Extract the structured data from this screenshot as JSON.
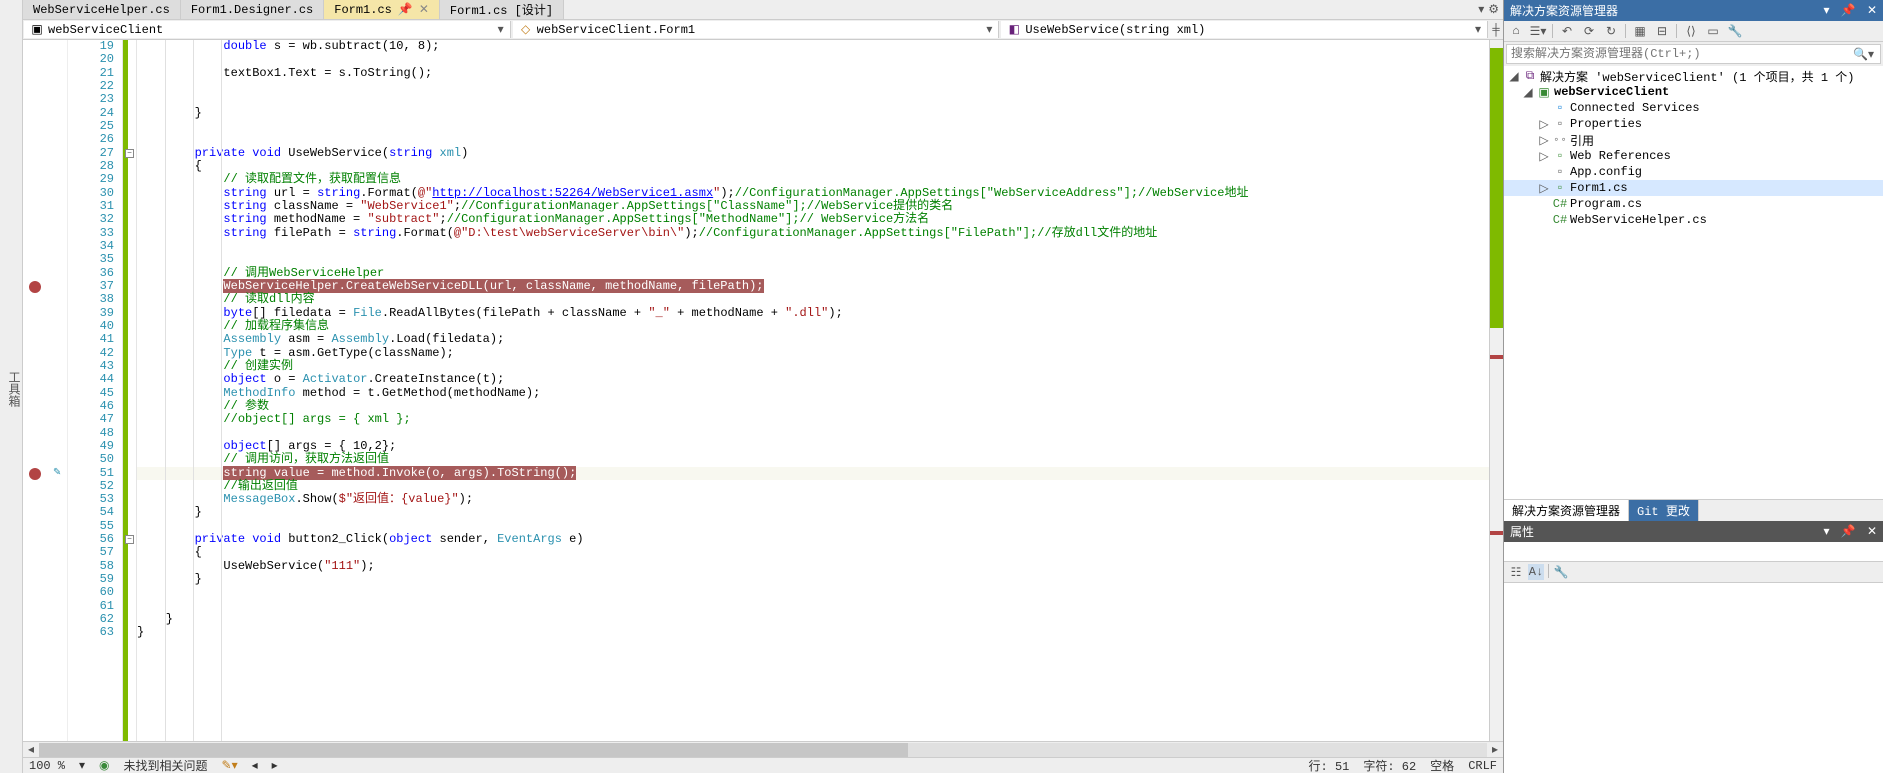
{
  "leftRail": {
    "label": "工具箱"
  },
  "tabs": [
    {
      "label": "WebServiceHelper.cs",
      "active": false,
      "pinned": false
    },
    {
      "label": "Form1.Designer.cs",
      "active": false,
      "pinned": false
    },
    {
      "label": "Form1.cs",
      "active": true,
      "pinned": true
    },
    {
      "label": "Form1.cs [设计]",
      "active": false,
      "pinned": false
    }
  ],
  "nav": {
    "scope": {
      "icon": "project-icon",
      "text": "webServiceClient"
    },
    "class": {
      "icon": "class-icon",
      "text": "webServiceClient.Form1"
    },
    "member": {
      "icon": "method-icon",
      "text": "UseWebService(string xml)"
    }
  },
  "lineStart": 19,
  "code": [
    {
      "n": 19,
      "t": "            double s = wb.subtract(10, 8);",
      "seg": [
        [
          "id",
          "            "
        ],
        [
          "kw",
          "double"
        ],
        [
          "id",
          " s = wb.subtract(10, 8);"
        ]
      ]
    },
    {
      "n": 20,
      "t": "",
      "seg": []
    },
    {
      "n": 21,
      "t": "            textBox1.Text = s.ToString();",
      "seg": [
        [
          "id",
          "            textBox1.Text = s.ToString();"
        ]
      ]
    },
    {
      "n": 22,
      "t": "",
      "seg": []
    },
    {
      "n": 23,
      "t": "",
      "seg": []
    },
    {
      "n": 24,
      "t": "        }",
      "seg": [
        [
          "id",
          "        }"
        ]
      ]
    },
    {
      "n": 25,
      "t": "",
      "seg": []
    },
    {
      "n": 26,
      "t": "",
      "seg": []
    },
    {
      "n": 27,
      "t": "        private void UseWebService(string xml)",
      "fold": "-",
      "seg": [
        [
          "id",
          "        "
        ],
        [
          "kw",
          "private"
        ],
        [
          "id",
          " "
        ],
        [
          "kw",
          "void"
        ],
        [
          "id",
          " UseWebService("
        ],
        [
          "kw",
          "string"
        ],
        [
          "id",
          " "
        ],
        [
          "typ",
          "xml"
        ],
        [
          "id",
          ")"
        ]
      ]
    },
    {
      "n": 28,
      "t": "        {",
      "seg": [
        [
          "id",
          "        {"
        ]
      ]
    },
    {
      "n": 29,
      "t": "            // 读取配置文件，获取配置信息",
      "seg": [
        [
          "com",
          "            // 读取配置文件，获取配置信息"
        ]
      ]
    },
    {
      "n": 30,
      "t": "            string url = string.Format(@\"http://localhost:52264/WebService1.asmx\");//ConfigurationManager.AppSettings[\"WebServiceAddress\"];//WebService地址",
      "seg": [
        [
          "id",
          "            "
        ],
        [
          "kw",
          "string"
        ],
        [
          "id",
          " url = "
        ],
        [
          "kw",
          "string"
        ],
        [
          "id",
          ".Format("
        ],
        [
          "str",
          "@\""
        ],
        [
          "lnk",
          "http://localhost:52264/WebService1.asmx"
        ],
        [
          "str",
          "\""
        ],
        [
          "id",
          ");"
        ],
        [
          "com",
          "//ConfigurationManager.AppSettings[\"WebServiceAddress\"];//WebService地址"
        ]
      ]
    },
    {
      "n": 31,
      "t": "            string className = \"WebService1\";//ConfigurationManager.AppSettings[\"ClassName\"];//WebService提供的类名",
      "seg": [
        [
          "id",
          "            "
        ],
        [
          "kw",
          "string"
        ],
        [
          "id",
          " className = "
        ],
        [
          "str",
          "\"WebService1\""
        ],
        [
          "id",
          ";"
        ],
        [
          "com",
          "//ConfigurationManager.AppSettings[\"ClassName\"];//WebService提供的类名"
        ]
      ]
    },
    {
      "n": 32,
      "t": "            string methodName = \"subtract\";//ConfigurationManager.AppSettings[\"MethodName\"];// WebService方法名",
      "seg": [
        [
          "id",
          "            "
        ],
        [
          "kw",
          "string"
        ],
        [
          "id",
          " methodName = "
        ],
        [
          "str",
          "\"subtract\""
        ],
        [
          "id",
          ";"
        ],
        [
          "com",
          "//ConfigurationManager.AppSettings[\"MethodName\"];// WebService方法名"
        ]
      ]
    },
    {
      "n": 33,
      "t": "            string filePath = string.Format(@\"D:\\test\\webServiceServer\\bin\\\");//ConfigurationManager.AppSettings[\"FilePath\"];//存放dll文件的地址",
      "seg": [
        [
          "id",
          "            "
        ],
        [
          "kw",
          "string"
        ],
        [
          "id",
          " filePath = "
        ],
        [
          "kw",
          "string"
        ],
        [
          "id",
          ".Format("
        ],
        [
          "str",
          "@\"D:\\test\\webServiceServer\\bin\\\""
        ],
        [
          "id",
          ");"
        ],
        [
          "com",
          "//ConfigurationManager.AppSettings[\"FilePath\"];//存放dll文件的地址"
        ]
      ]
    },
    {
      "n": 34,
      "t": "",
      "seg": []
    },
    {
      "n": 35,
      "t": "",
      "seg": []
    },
    {
      "n": 36,
      "t": "            // 调用WebServiceHelper",
      "seg": [
        [
          "com",
          "            // 调用WebServiceHelper"
        ]
      ]
    },
    {
      "n": 37,
      "t": "            WebServiceHelper.CreateWebServiceDLL(url, className, methodName, filePath);",
      "bp": true,
      "seg": [
        [
          "id",
          "            "
        ],
        [
          "hl1",
          "WebServiceHelper.CreateWebServiceDLL(url, className, methodName, filePath);"
        ]
      ]
    },
    {
      "n": 38,
      "t": "            // 读取dll内容",
      "seg": [
        [
          "com",
          "            // 读取dll内容"
        ]
      ]
    },
    {
      "n": 39,
      "t": "            byte[] filedata = File.ReadAllBytes(filePath + className + \"_\" + methodName + \".dll\");",
      "seg": [
        [
          "id",
          "            "
        ],
        [
          "kw",
          "byte"
        ],
        [
          "id",
          "[] filedata = "
        ],
        [
          "typ",
          "File"
        ],
        [
          "id",
          ".ReadAllBytes(filePath + className + "
        ],
        [
          "str",
          "\"_\""
        ],
        [
          "id",
          " + methodName + "
        ],
        [
          "str",
          "\".dll\""
        ],
        [
          "id",
          ");"
        ]
      ]
    },
    {
      "n": 40,
      "t": "            // 加载程序集信息",
      "seg": [
        [
          "com",
          "            // 加载程序集信息"
        ]
      ]
    },
    {
      "n": 41,
      "t": "            Assembly asm = Assembly.Load(filedata);",
      "seg": [
        [
          "id",
          "            "
        ],
        [
          "typ",
          "Assembly"
        ],
        [
          "id",
          " asm = "
        ],
        [
          "typ",
          "Assembly"
        ],
        [
          "id",
          ".Load(filedata);"
        ]
      ]
    },
    {
      "n": 42,
      "t": "            Type t = asm.GetType(className);",
      "seg": [
        [
          "id",
          "            "
        ],
        [
          "typ",
          "Type"
        ],
        [
          "id",
          " t = asm.GetType(className);"
        ]
      ]
    },
    {
      "n": 43,
      "t": "            // 创建实例",
      "seg": [
        [
          "com",
          "            // 创建实例"
        ]
      ]
    },
    {
      "n": 44,
      "t": "            object o = Activator.CreateInstance(t);",
      "seg": [
        [
          "id",
          "            "
        ],
        [
          "kw",
          "object"
        ],
        [
          "id",
          " o = "
        ],
        [
          "typ",
          "Activator"
        ],
        [
          "id",
          ".CreateInstance(t);"
        ]
      ]
    },
    {
      "n": 45,
      "t": "            MethodInfo method = t.GetMethod(methodName);",
      "seg": [
        [
          "id",
          "            "
        ],
        [
          "typ",
          "MethodInfo"
        ],
        [
          "id",
          " method = t.GetMethod(methodName);"
        ]
      ]
    },
    {
      "n": 46,
      "t": "            // 参数",
      "seg": [
        [
          "com",
          "            // 参数"
        ]
      ]
    },
    {
      "n": 47,
      "t": "            //object[] args = { xml };",
      "seg": [
        [
          "com",
          "            //object[] args = { xml };"
        ]
      ]
    },
    {
      "n": 48,
      "t": "",
      "seg": []
    },
    {
      "n": 49,
      "t": "            object[] args = { 10,2};",
      "seg": [
        [
          "id",
          "            "
        ],
        [
          "kw",
          "object"
        ],
        [
          "id",
          "[] args = { 10,2};"
        ]
      ]
    },
    {
      "n": 50,
      "t": "            // 调用访问，获取方法返回值",
      "seg": [
        [
          "com",
          "            // 调用访问，获取方法返回值"
        ]
      ]
    },
    {
      "n": 51,
      "t": "            string value = method.Invoke(o, args).ToString();",
      "bp": true,
      "edit": true,
      "cur": true,
      "seg": [
        [
          "id",
          "            "
        ],
        [
          "hl1",
          "string value = method.Invoke(o, args).ToString();"
        ]
      ]
    },
    {
      "n": 52,
      "t": "            //输出返回值",
      "seg": [
        [
          "com",
          "            //输出返回值"
        ]
      ]
    },
    {
      "n": 53,
      "t": "            MessageBox.Show($\"返回值：{value}\");",
      "seg": [
        [
          "id",
          "            "
        ],
        [
          "typ",
          "MessageBox"
        ],
        [
          "id",
          ".Show("
        ],
        [
          "str",
          "$\"返回值：{value}\""
        ],
        [
          "id",
          ");"
        ]
      ]
    },
    {
      "n": 54,
      "t": "        }",
      "seg": [
        [
          "id",
          "        }"
        ]
      ]
    },
    {
      "n": 55,
      "t": "",
      "seg": []
    },
    {
      "n": 56,
      "t": "        private void button2_Click(object sender, EventArgs e)",
      "fold": "-",
      "seg": [
        [
          "id",
          "        "
        ],
        [
          "kw",
          "private"
        ],
        [
          "id",
          " "
        ],
        [
          "kw",
          "void"
        ],
        [
          "id",
          " button2_Click("
        ],
        [
          "kw",
          "object"
        ],
        [
          "id",
          " sender, "
        ],
        [
          "typ",
          "EventArgs"
        ],
        [
          "id",
          " e)"
        ]
      ]
    },
    {
      "n": 57,
      "t": "        {",
      "seg": [
        [
          "id",
          "        {"
        ]
      ]
    },
    {
      "n": 58,
      "t": "            UseWebService(\"111\");",
      "seg": [
        [
          "id",
          "            UseWebService("
        ],
        [
          "str",
          "\"111\""
        ],
        [
          "id",
          ");"
        ]
      ]
    },
    {
      "n": 59,
      "t": "        }",
      "seg": [
        [
          "id",
          "        }"
        ]
      ]
    },
    {
      "n": 60,
      "t": "",
      "seg": []
    },
    {
      "n": 61,
      "t": "",
      "seg": []
    },
    {
      "n": 62,
      "t": "    }",
      "seg": [
        [
          "id",
          "    }"
        ]
      ]
    },
    {
      "n": 63,
      "t": "}",
      "seg": [
        [
          "id",
          "}"
        ]
      ]
    }
  ],
  "status": {
    "zoom": "100 %",
    "issues": "未找到相关问题",
    "line": "行: 51",
    "col": "字符: 62",
    "spc": "空格",
    "eol": "CRLF"
  },
  "solutionExplorer": {
    "title": "解决方案资源管理器",
    "searchPlaceholder": "搜索解决方案资源管理器(Ctrl+;)",
    "solution": "解决方案 'webServiceClient' (1 个项目，共 1 个)",
    "project": "webServiceClient",
    "nodes": [
      {
        "label": "Connected Services",
        "ico": "svc",
        "tw": ""
      },
      {
        "label": "Properties",
        "ico": "ref",
        "tw": "▷"
      },
      {
        "label": "引用",
        "ico": "ref",
        "tw": "▷",
        "prefix": "◦◦ "
      },
      {
        "label": "Web References",
        "ico": "proj",
        "tw": "▷"
      },
      {
        "label": "App.config",
        "ico": "cfg",
        "tw": ""
      },
      {
        "label": "Form1.cs",
        "ico": "cs",
        "tw": "▷",
        "sel": true
      },
      {
        "label": "Program.cs",
        "ico": "cs",
        "tw": "",
        "prefix": "C# "
      },
      {
        "label": "WebServiceHelper.cs",
        "ico": "cs",
        "tw": "",
        "prefix": "C# "
      }
    ]
  },
  "bottomTabs": {
    "a": "解决方案资源管理器",
    "b": "Git 更改"
  },
  "props": {
    "title": "属性"
  }
}
